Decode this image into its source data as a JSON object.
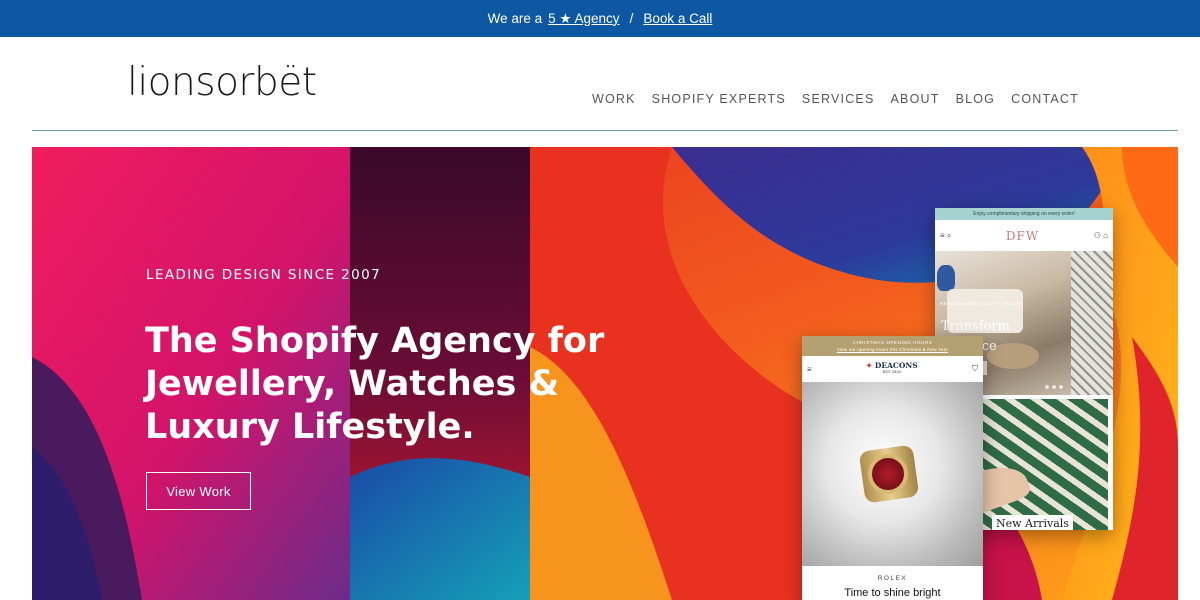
{
  "announcement": {
    "prefix": "We are a",
    "rating_link": "5 ★ Agency",
    "separator": "/",
    "call_link": "Book a Call"
  },
  "header": {
    "logo": "lionsorbët",
    "nav": [
      "WORK",
      "SHOPIFY EXPERTS",
      "SERVICES",
      "ABOUT",
      "BLOG",
      "CONTACT"
    ]
  },
  "hero": {
    "eyebrow": "LEADING DESIGN SINCE 2007",
    "headline_lines": [
      "The Shopify Agency for",
      "Jewellery, Watches &",
      "Luxury Lifestyle."
    ],
    "cta": "View Work"
  },
  "mockup_back": {
    "promo": "Enjoy complimentary shipping on every order!",
    "logo": "DFW",
    "small_text": "RE-DESIGNED QUALITY DECOR",
    "title_lines": [
      "Transform",
      "space"
    ],
    "section": "New Arrivals"
  },
  "mockup_front": {
    "promo": "CHRISTMAS OPENING HOURS",
    "promo_sub": "View our opening hours this Christmas & New Year",
    "logo": "DEACONS",
    "logo_est": "EST. 1826",
    "brand": "ROLEX",
    "tagline": "Time to shine bright"
  },
  "colors": {
    "announcement_bg": "#0d57a3",
    "header_rule": "#6b9aa8",
    "nav_text": "#555555"
  }
}
